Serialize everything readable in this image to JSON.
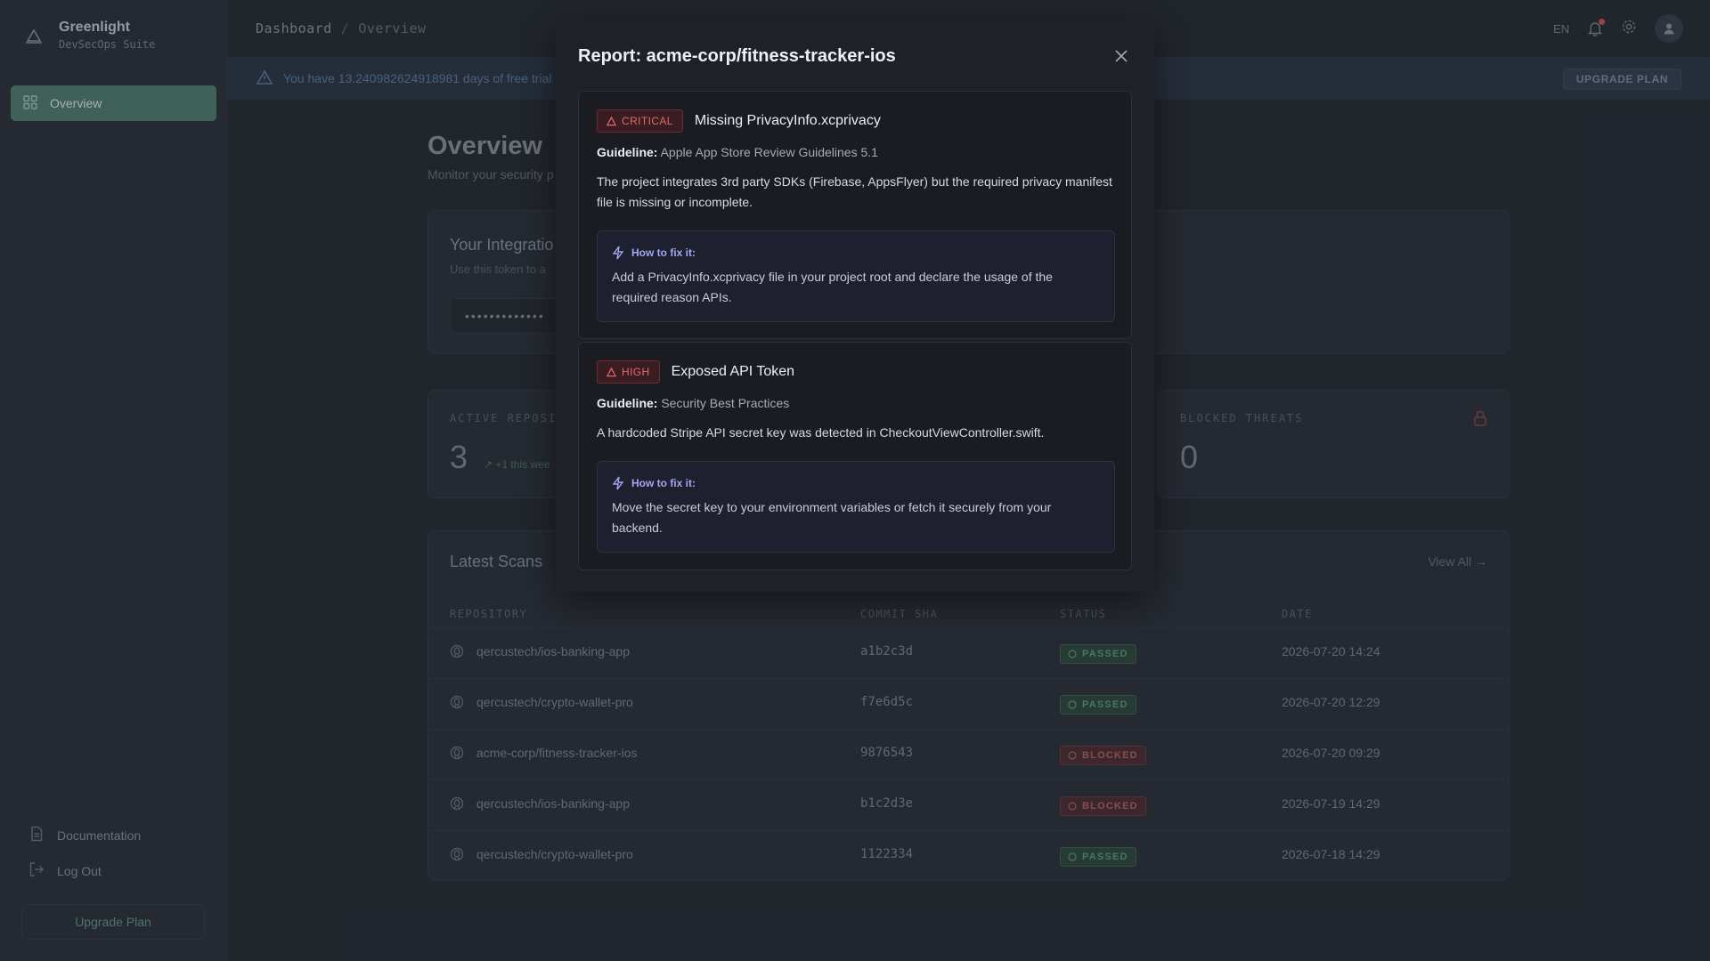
{
  "brand": {
    "name": "Greenlight",
    "subtitle": "DevSecOps Suite"
  },
  "sidebar": {
    "nav": [
      {
        "label": "Overview",
        "icon": "grid-icon",
        "active": true
      }
    ],
    "bottom": [
      {
        "label": "Documentation",
        "icon": "document-icon"
      },
      {
        "label": "Log Out",
        "icon": "logout-icon"
      }
    ],
    "upgrade_label": "Upgrade Plan"
  },
  "header": {
    "breadcrumb": [
      "Dashboard",
      "Overview"
    ],
    "language": "EN"
  },
  "trial_banner": {
    "text": "You have 13.240982624918981 days of free trial",
    "button": "UPGRADE PLAN"
  },
  "overview": {
    "title": "Overview",
    "subtitle": "Monitor your security p",
    "integration": {
      "title": "Your Integratio",
      "subtitle": "Use this token to a",
      "token_mask": "•••••••••••••"
    },
    "stats": [
      {
        "label": "ACTIVE REPOSIT",
        "value": "3",
        "trend": "+1 this wee"
      },
      {
        "label": "BLOCKED THREATS",
        "value": "0"
      }
    ]
  },
  "scans": {
    "title": "Latest Scans",
    "view_all": "View All",
    "columns": [
      "REPOSITORY",
      "COMMIT SHA",
      "STATUS",
      "DATE"
    ],
    "rows": [
      {
        "repo": "qercustech/ios-banking-app",
        "sha": "a1b2c3d",
        "status": "PASSED",
        "date": "2026-07-20 14:24"
      },
      {
        "repo": "qercustech/crypto-wallet-pro",
        "sha": "f7e6d5c",
        "status": "PASSED",
        "date": "2026-07-20 12:29"
      },
      {
        "repo": "acme-corp/fitness-tracker-ios",
        "sha": "9876543",
        "status": "BLOCKED",
        "date": "2026-07-20 09:29"
      },
      {
        "repo": "qercustech/ios-banking-app",
        "sha": "b1c2d3e",
        "status": "BLOCKED",
        "date": "2026-07-19 14:29"
      },
      {
        "repo": "qercustech/crypto-wallet-pro",
        "sha": "1122334",
        "status": "PASSED",
        "date": "2026-07-18 14:29"
      }
    ]
  },
  "modal": {
    "title": "Report: acme-corp/fitness-tracker-ios",
    "guideline_label": "Guideline:",
    "fix_label": "How to fix it:",
    "issues": [
      {
        "severity": "CRITICAL",
        "title": "Missing PrivacyInfo.xcprivacy",
        "guideline": "Apple App Store Review Guidelines 5.1",
        "description": "The project integrates 3rd party SDKs (Firebase, AppsFlyer) but the required privacy manifest file is missing or incomplete.",
        "fix": "Add a PrivacyInfo.xcprivacy file in your project root and declare the usage of the required reason APIs."
      },
      {
        "severity": "HIGH",
        "title": "Exposed API Token",
        "guideline": "Security Best Practices",
        "description": "A hardcoded Stripe API secret key was detected in CheckoutViewController.swift.",
        "fix": "Move the secret key to your environment variables or fetch it securely from your backend."
      }
    ]
  },
  "colors": {
    "accent": "#4f7e6e",
    "critical": "#e46a6a",
    "fix_accent": "#a3a8f0",
    "modal_bg": "#1f2128"
  }
}
